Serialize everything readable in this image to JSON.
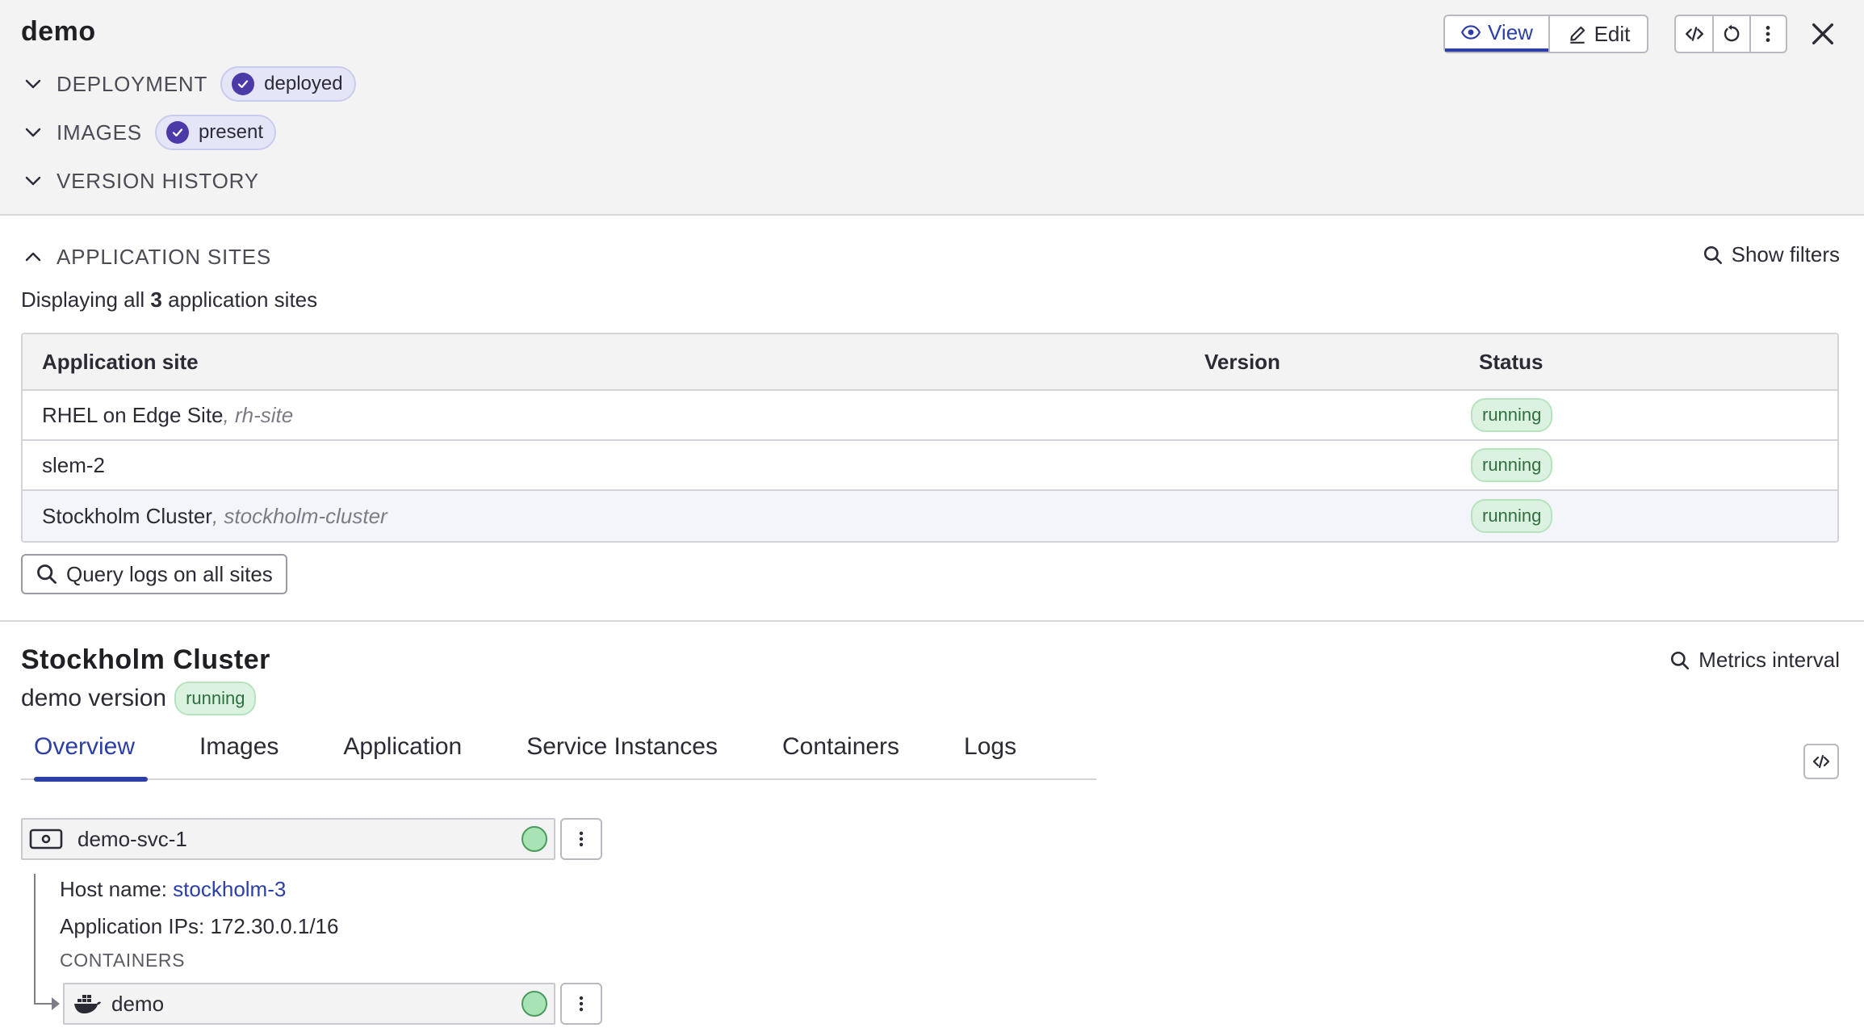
{
  "header": {
    "title": "demo",
    "view_label": "View",
    "edit_label": "Edit"
  },
  "sections": {
    "deployment": {
      "label": "DEPLOYMENT",
      "status": "deployed"
    },
    "images": {
      "label": "IMAGES",
      "status": "present"
    },
    "version_history": {
      "label": "VERSION HISTORY"
    }
  },
  "sites": {
    "label": "APPLICATION SITES",
    "show_filters": "Show filters",
    "displaying_prefix": "Displaying all",
    "count": "3",
    "displaying_suffix": "application sites",
    "columns": [
      "Application site",
      "Version",
      "Status"
    ],
    "rows": [
      {
        "name": "RHEL on Edge Site",
        "alias": ", rh-site",
        "version": "",
        "status": "running"
      },
      {
        "name": "slem-2",
        "alias": "",
        "version": "",
        "status": "running"
      },
      {
        "name": "Stockholm Cluster",
        "alias": ", stockholm-cluster",
        "version": "",
        "status": "running"
      }
    ],
    "query_logs": "Query logs on all sites"
  },
  "cluster": {
    "title": "Stockholm Cluster",
    "subtitle": "demo version",
    "status": "running",
    "metrics_interval": "Metrics interval",
    "tabs": [
      "Overview",
      "Images",
      "Application",
      "Service Instances",
      "Containers",
      "Logs"
    ],
    "active_tab": "Overview"
  },
  "overview": {
    "service_name": "demo-svc-1",
    "host_label": "Host name: ",
    "host_value": "stockholm-3",
    "ips_label": "Application IPs: ",
    "ips_value": "172.30.0.1/16",
    "containers_label": "CONTAINERS",
    "container_name": "demo"
  },
  "colors": {
    "accent": "#2b3fa6",
    "check_badge": "#4b3aa8",
    "running_bg": "#dcf2e0",
    "running_text": "#2f6f3f",
    "status_dot": "#a8e3b4"
  }
}
